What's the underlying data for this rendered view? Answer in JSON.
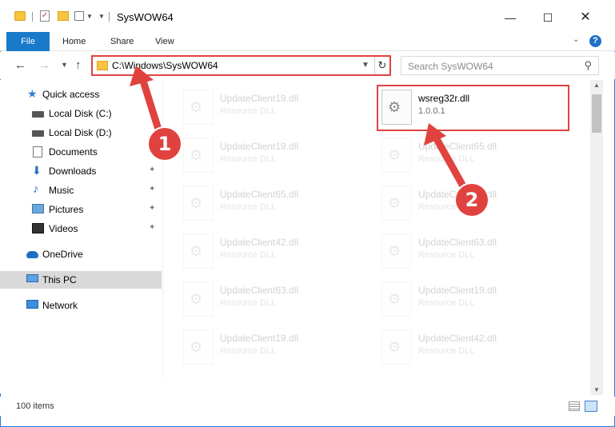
{
  "window": {
    "title": "SysWOW64",
    "controls": {
      "minimize": "—",
      "maximize": "☐",
      "close": "✕"
    }
  },
  "ribbon": {
    "tabs": [
      "File",
      "Home",
      "Share",
      "View"
    ],
    "expand_icon": "chevron-down-icon",
    "help": "?"
  },
  "nav": {
    "back": "←",
    "forward": "→",
    "recent": "⌄",
    "up": "↑",
    "address": "C:\\Windows\\SysWOW64",
    "address_dropdown": "⌄",
    "refresh": "↻",
    "search_placeholder": "Search SysWOW64",
    "search_icon": "⌕"
  },
  "sidebar": {
    "items": [
      {
        "label": "Quick access",
        "icon": "star-icon"
      },
      {
        "label": "Local Disk (C:)",
        "icon": "disk-icon"
      },
      {
        "label": "Local Disk (D:)",
        "icon": "disk-icon"
      },
      {
        "label": "Documents",
        "icon": "document-icon",
        "pinned": true
      },
      {
        "label": "Downloads",
        "icon": "download-icon",
        "pinned": true
      },
      {
        "label": "Music",
        "icon": "music-icon",
        "pinned": true
      },
      {
        "label": "Pictures",
        "icon": "picture-icon",
        "pinned": true
      },
      {
        "label": "Videos",
        "icon": "video-icon",
        "pinned": true
      },
      {
        "label": "OneDrive",
        "icon": "cloud-icon"
      },
      {
        "label": "This PC",
        "icon": "pc-icon",
        "selected": true
      },
      {
        "label": "Network",
        "icon": "network-icon"
      }
    ],
    "pin_glyph": "📌"
  },
  "files": [
    {
      "name": "UpdateClient19.dll",
      "type": "Resource DLL",
      "faded": true
    },
    {
      "name": "wsreg32r.dll",
      "type": "1.0.0.1",
      "faded": false
    },
    {
      "name": "UpdateClient19.dll",
      "type": "Resource DLL",
      "faded": true
    },
    {
      "name": "UpdateClient65.dll",
      "type": "Resource DLL",
      "faded": true
    },
    {
      "name": "UpdateClient65.dll",
      "type": "Resource DLL",
      "faded": true
    },
    {
      "name": "UpdateClient71.dll",
      "type": "Resource DLL",
      "faded": true
    },
    {
      "name": "UpdateClient42.dll",
      "type": "Resource DLL",
      "faded": true
    },
    {
      "name": "UpdateClient63.dll",
      "type": "Resource DLL",
      "faded": true
    },
    {
      "name": "UpdateClient63.dll",
      "type": "Resource DLL",
      "faded": true
    },
    {
      "name": "UpdateClient19.dll",
      "type": "Resource DLL",
      "faded": true
    },
    {
      "name": "UpdateClient19.dll",
      "type": "Resource DLL",
      "faded": true
    },
    {
      "name": "UpdateClient42.dll",
      "type": "Resource DLL",
      "faded": true
    }
  ],
  "status": {
    "item_count": "100 items"
  },
  "callouts": [
    "1",
    "2"
  ],
  "colors": {
    "accent": "#1979ca",
    "highlight": "#e0433f"
  }
}
